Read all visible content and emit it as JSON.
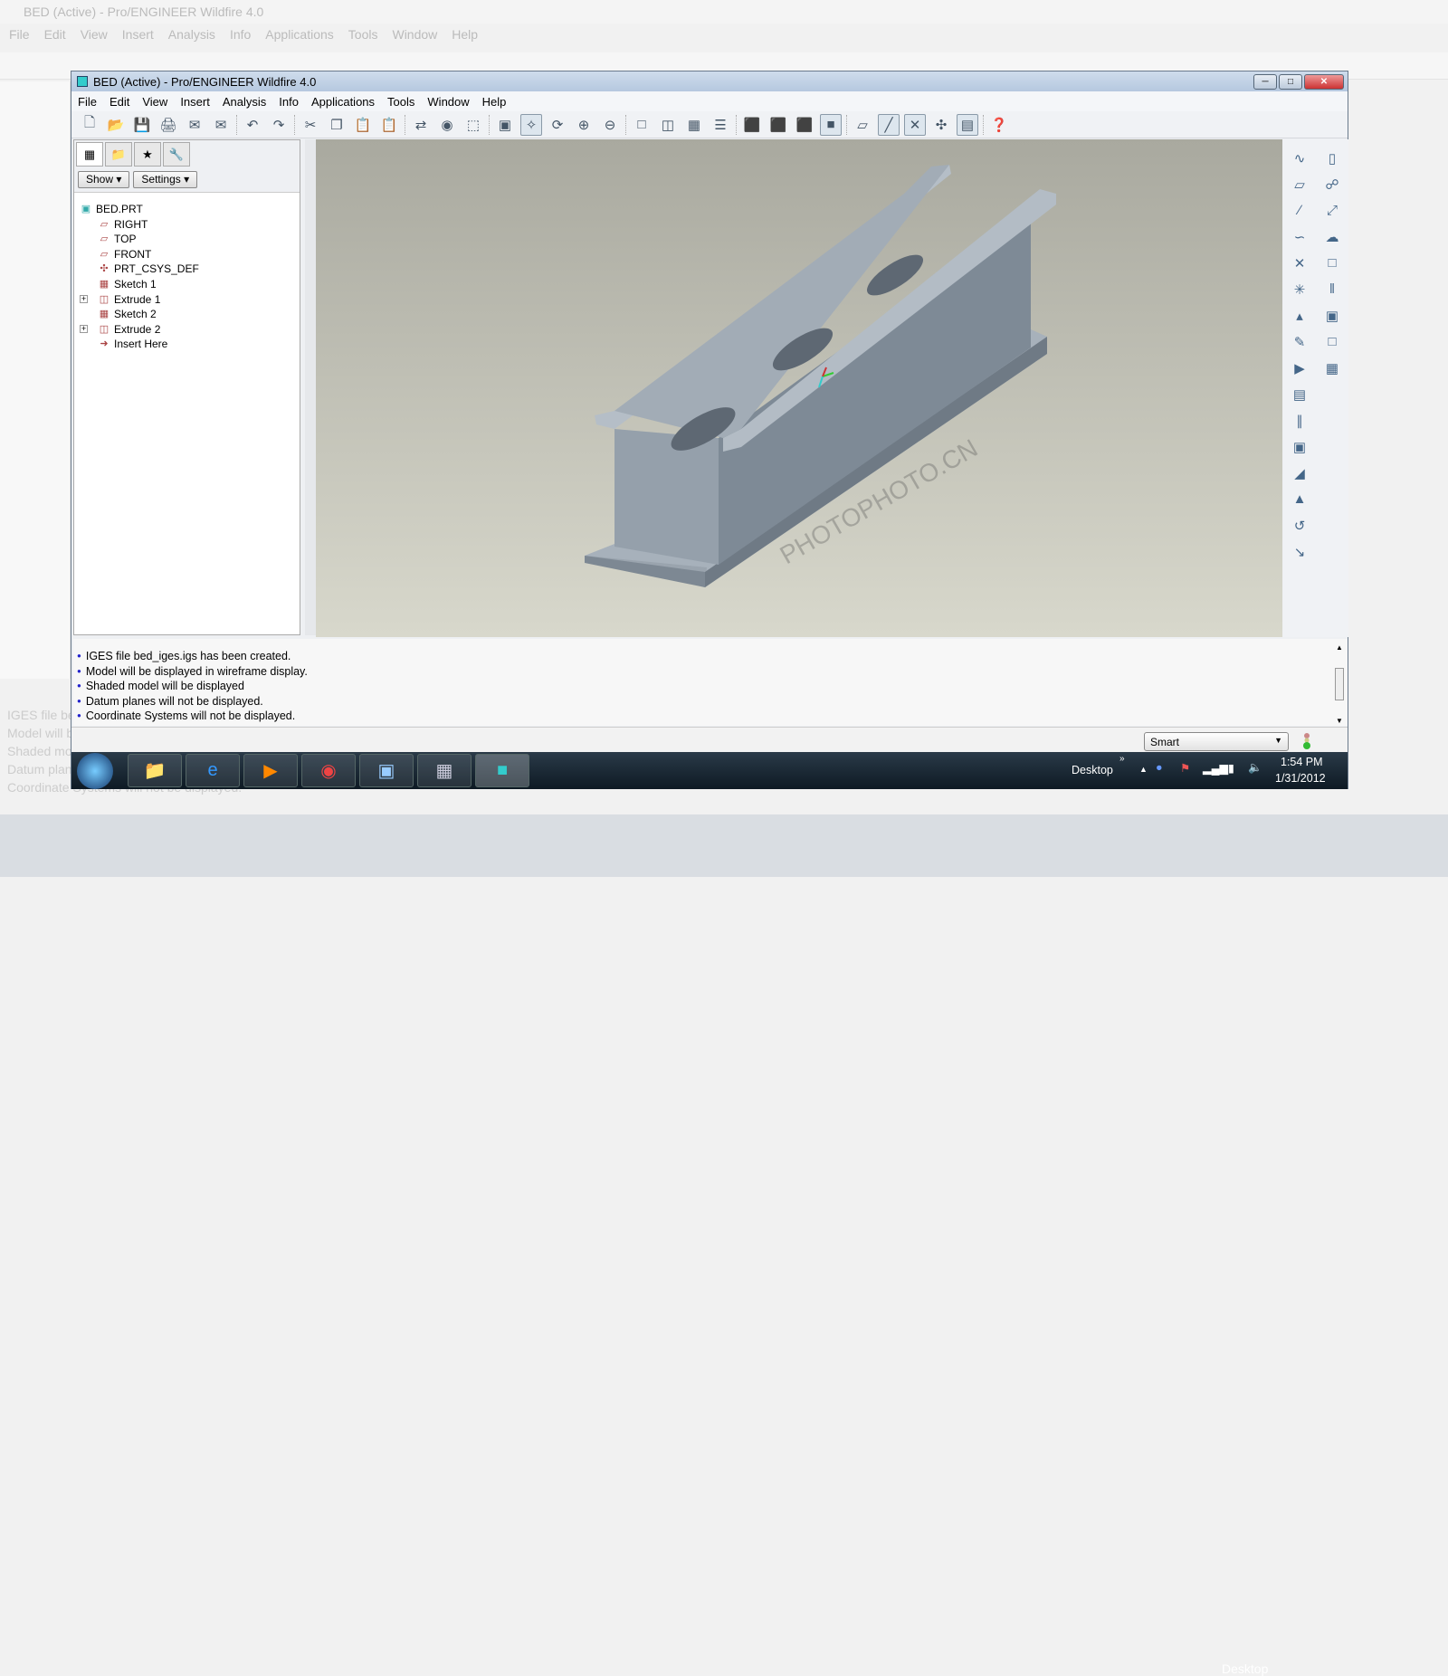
{
  "window": {
    "title": "BED (Active) - Pro/ENGINEER Wildfire 4.0",
    "controls": [
      "minimize",
      "maximize",
      "close"
    ]
  },
  "menu": [
    "File",
    "Edit",
    "View",
    "Insert",
    "Analysis",
    "Info",
    "Applications",
    "Tools",
    "Window",
    "Help"
  ],
  "toolbar_icons": [
    "new",
    "open",
    "save",
    "print",
    "email",
    "email-attach",
    "undo",
    "redo",
    "cut",
    "copy",
    "paste",
    "paste-special",
    "regenerate",
    "find",
    "select-box",
    "repaint",
    "spin-center",
    "orient",
    "zoom-in",
    "zoom-out",
    "refit",
    "view-manager",
    "saved-views",
    "layers",
    "wireframe",
    "hidden-line",
    "no-hidden",
    "shaded",
    "datum-planes",
    "datum-axes",
    "datum-points",
    "coord-systems",
    "annotations",
    "context-help"
  ],
  "model_tree": {
    "buttons": {
      "show": "Show",
      "settings": "Settings"
    },
    "root": "BED.PRT",
    "items": [
      {
        "label": "RIGHT",
        "icon": "datum-plane"
      },
      {
        "label": "TOP",
        "icon": "datum-plane"
      },
      {
        "label": "FRONT",
        "icon": "datum-plane"
      },
      {
        "label": "PRT_CSYS_DEF",
        "icon": "csys"
      },
      {
        "label": "Sketch 1",
        "icon": "sketch"
      },
      {
        "label": "Extrude 1",
        "icon": "extrude",
        "expandable": true
      },
      {
        "label": "Sketch 2",
        "icon": "sketch"
      },
      {
        "label": "Extrude 2",
        "icon": "extrude",
        "expandable": true
      },
      {
        "label": "Insert Here",
        "icon": "insert-arrow"
      }
    ]
  },
  "messages": [
    "IGES file bed_iges.igs has been created.",
    "Model will be displayed in wireframe display.",
    "Shaded model will be displayed",
    "Datum planes will not be displayed.",
    "Coordinate Systems will not be displayed."
  ],
  "status": {
    "filter": "Smart"
  },
  "taskbar": {
    "desktop": "Desktop",
    "time": "1:54 PM",
    "date": "1/31/2012"
  },
  "watermark": "PHOTOPHOTO.CN",
  "colors": {
    "graphics_top": "#a9a99f",
    "graphics_bottom": "#d8d8cc",
    "model": "#8d99a6",
    "accent": "#2222cc"
  }
}
